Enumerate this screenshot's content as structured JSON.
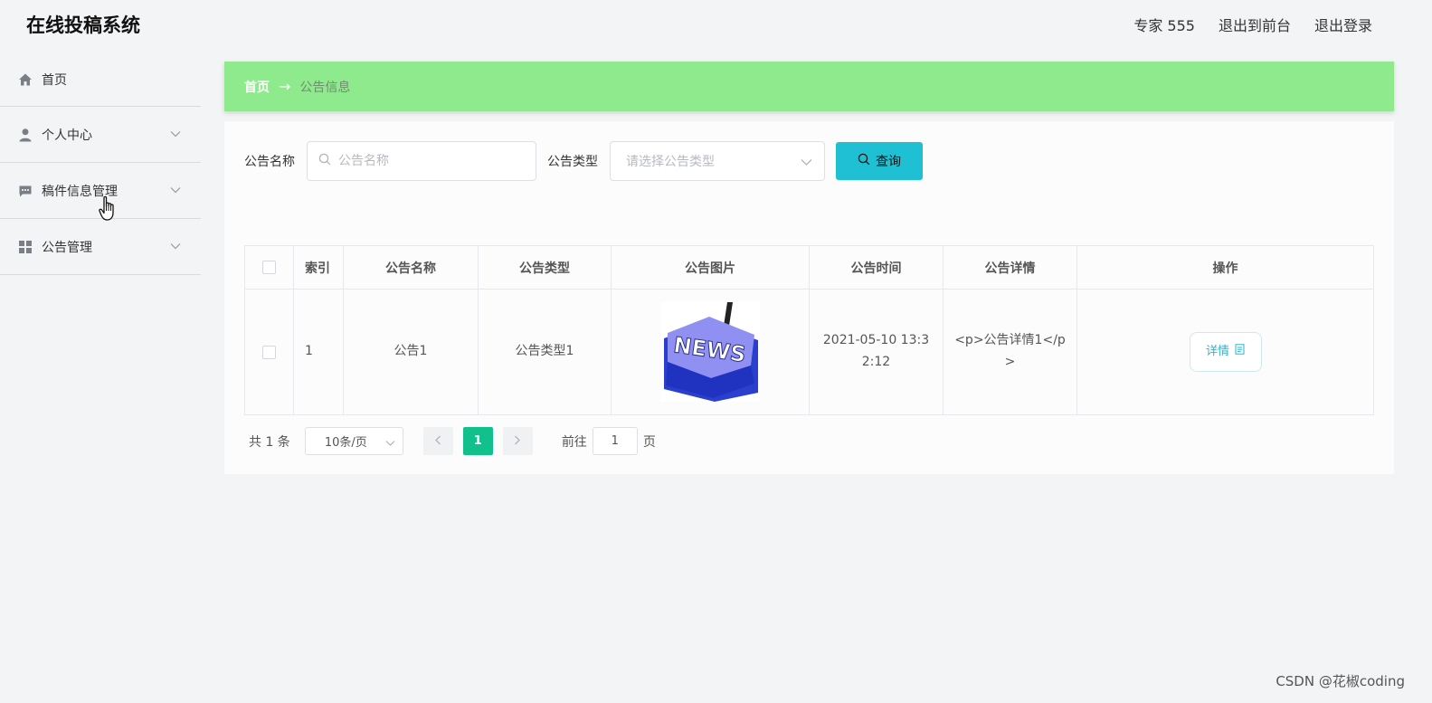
{
  "header": {
    "app_title": "在线投稿系统",
    "user_label": "专家 555",
    "exit_front": "退出到前台",
    "logout": "退出登录"
  },
  "sidebar": {
    "items": [
      {
        "label": "首页",
        "icon": "home-icon"
      },
      {
        "label": "个人中心",
        "icon": "user-icon"
      },
      {
        "label": "稿件信息管理",
        "icon": "chat-icon"
      },
      {
        "label": "公告管理",
        "icon": "grid-icon"
      }
    ]
  },
  "breadcrumb": {
    "home": "首页",
    "arrow": "→",
    "current": "公告信息"
  },
  "search": {
    "name_label": "公告名称",
    "name_placeholder": "公告名称",
    "type_label": "公告类型",
    "type_placeholder": "请选择公告类型",
    "query_button": "查询"
  },
  "table": {
    "headers": [
      "",
      "索引",
      "公告名称",
      "公告类型",
      "公告图片",
      "公告时间",
      "公告详情",
      "操作"
    ],
    "rows": [
      {
        "index": "1",
        "name": "公告1",
        "type": "公告类型1",
        "image_text": "NEWS",
        "time": "2021-05-10 13:32:12",
        "detail": "<p>公告详情1</p>",
        "action": "详情"
      }
    ]
  },
  "pagination": {
    "total": "共 1 条",
    "page_size": "10条/页",
    "current_page": "1",
    "goto_label": "前往",
    "goto_value": "1",
    "page_suffix": "页"
  },
  "watermark": "CSDN @花椒coding",
  "colors": {
    "breadcrumb_bg": "#8eea8c",
    "query_button": "#1fc0d4",
    "active_page": "#12c08c"
  }
}
